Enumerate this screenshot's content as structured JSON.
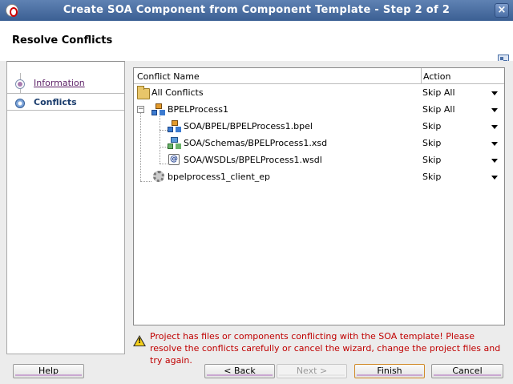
{
  "window": {
    "title": "Create SOA Component from Component Template - Step 2 of 2"
  },
  "header": {
    "page_title": "Resolve Conflicts"
  },
  "nav": {
    "items": [
      {
        "label": "Information"
      },
      {
        "label": "Conflicts"
      }
    ]
  },
  "table": {
    "col_name": "Conflict Name",
    "col_action": "Action",
    "rows": [
      {
        "name": "All Conflicts",
        "action": "Skip All"
      },
      {
        "name": "BPELProcess1",
        "action": "Skip All"
      },
      {
        "name": "SOA/BPEL/BPELProcess1.bpel",
        "action": "Skip"
      },
      {
        "name": "SOA/Schemas/BPELProcess1.xsd",
        "action": "Skip"
      },
      {
        "name": "SOA/WSDLs/BPELProcess1.wsdl",
        "action": "Skip"
      },
      {
        "name": "bpelprocess1_client_ep",
        "action": "Skip"
      }
    ]
  },
  "warning": {
    "text": "Project has files or components conflicting with the SOA template! Please resolve the conflicts carefully or cancel the wizard, change the project files and try again."
  },
  "buttons": {
    "help": "Help",
    "back": "< Back",
    "next": "Next >",
    "finish": "Finish",
    "cancel": "Cancel"
  },
  "icons": {
    "wsdl_glyph": "@"
  }
}
